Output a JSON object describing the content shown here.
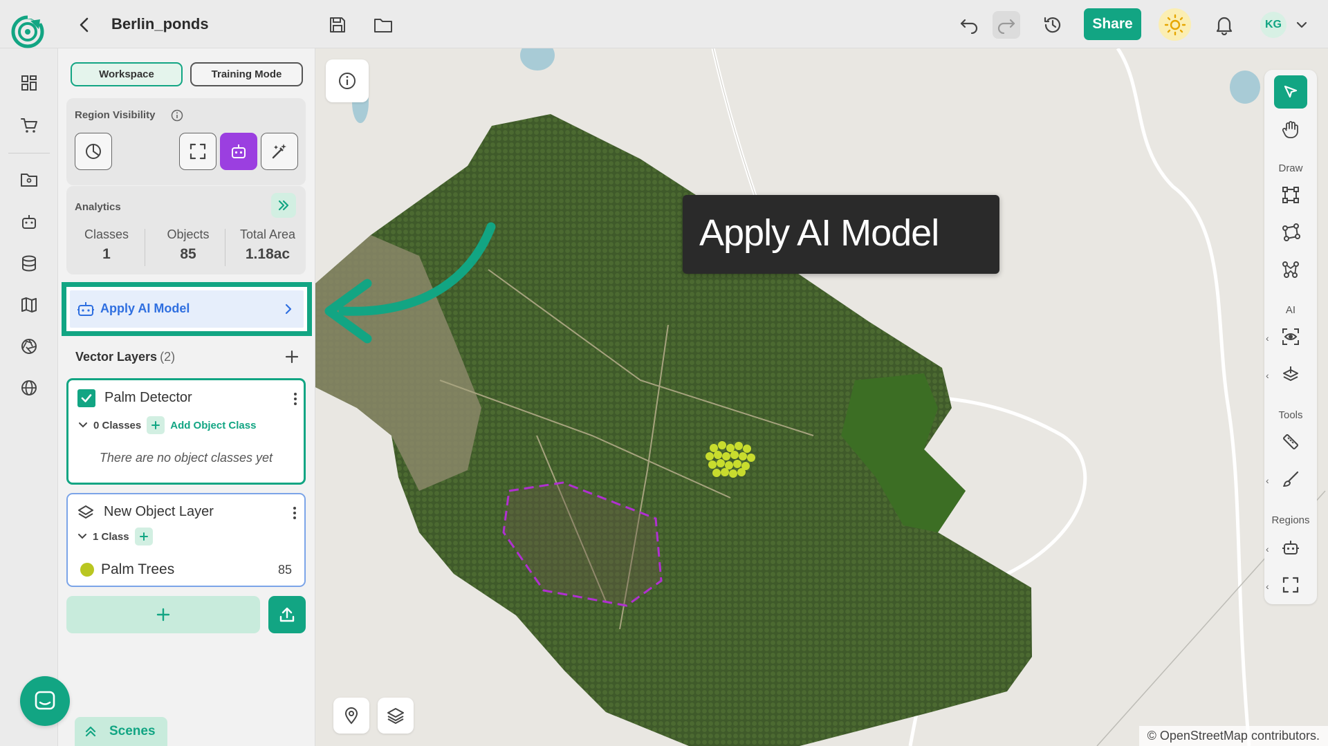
{
  "header": {
    "project_title": "Berlin_ponds",
    "share_label": "Share",
    "avatar_initials": "KG"
  },
  "panel": {
    "tabs": [
      "Workspace",
      "Training Mode"
    ],
    "region_visibility": {
      "title": "Region Visibility"
    },
    "analytics": {
      "title": "Analytics",
      "stats": [
        {
          "label": "Classes",
          "value": "1"
        },
        {
          "label": "Objects",
          "value": "85"
        },
        {
          "label": "Total Area",
          "value": "1.18ac"
        }
      ]
    },
    "apply_ai_model_label": "Apply AI Model",
    "vector_layers": {
      "title": "Vector Layers",
      "count": "(2)",
      "layers": [
        {
          "name": "Palm Detector",
          "checked": true,
          "classes_label": "0 Classes",
          "add_class_label": "Add Object Class",
          "empty_text": "There are no object classes yet"
        },
        {
          "name": "New Object Layer",
          "classes_label": "1 Class",
          "classes": [
            {
              "name": "Palm Trees",
              "count": "85",
              "color": "#b9c621"
            }
          ]
        }
      ]
    },
    "scenes_label": "Scenes"
  },
  "map": {
    "tooltip_text": "Apply AI Model",
    "attribution": "© OpenStreetMap contributors."
  },
  "right_toolbar": {
    "sections": [
      "Draw",
      "AI",
      "Tools",
      "Regions"
    ]
  },
  "colors": {
    "brand": "#12a583",
    "accent_purple": "#9b3fe0",
    "link_blue": "#2f6fe0",
    "palm_class": "#b9c621"
  }
}
